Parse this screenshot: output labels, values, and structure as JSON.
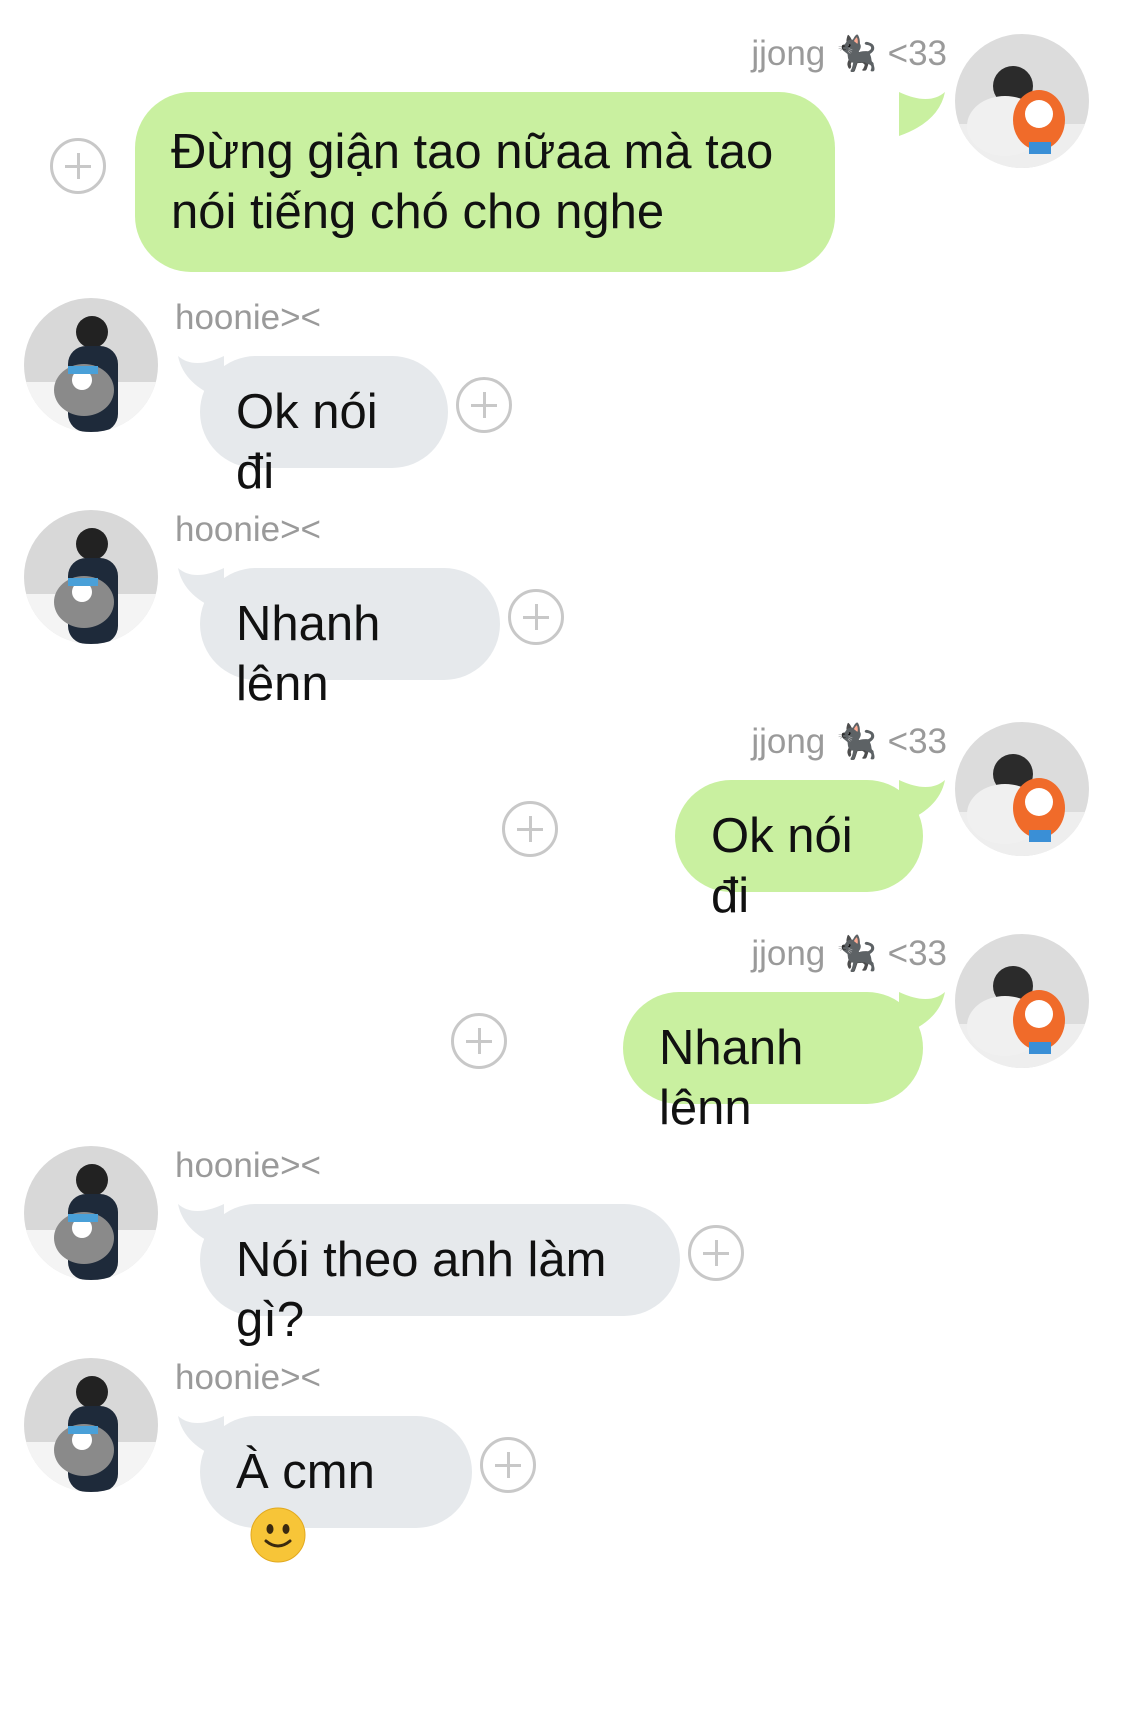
{
  "users": {
    "me": {
      "name": "jjong",
      "emoji": "🐈‍⬛",
      "suffix": "<33",
      "bubble_color": "#c9f0a0"
    },
    "other": {
      "name": "hoonie><",
      "bubble_color": "#e6e9ec"
    }
  },
  "messages": [
    {
      "from": "me",
      "text": "Đừng giận tao nữaa mà tao nói tiếng chó cho nghe"
    },
    {
      "from": "other",
      "text": "Ok nói đi"
    },
    {
      "from": "other",
      "text": "Nhanh lênn"
    },
    {
      "from": "me",
      "text": "Ok nói đi"
    },
    {
      "from": "me",
      "text": "Nhanh lênn"
    },
    {
      "from": "other",
      "text": "Nói theo anh làm gì?"
    },
    {
      "from": "other",
      "text": "À cmn",
      "emoji": "slightly-smiling-face"
    }
  ]
}
